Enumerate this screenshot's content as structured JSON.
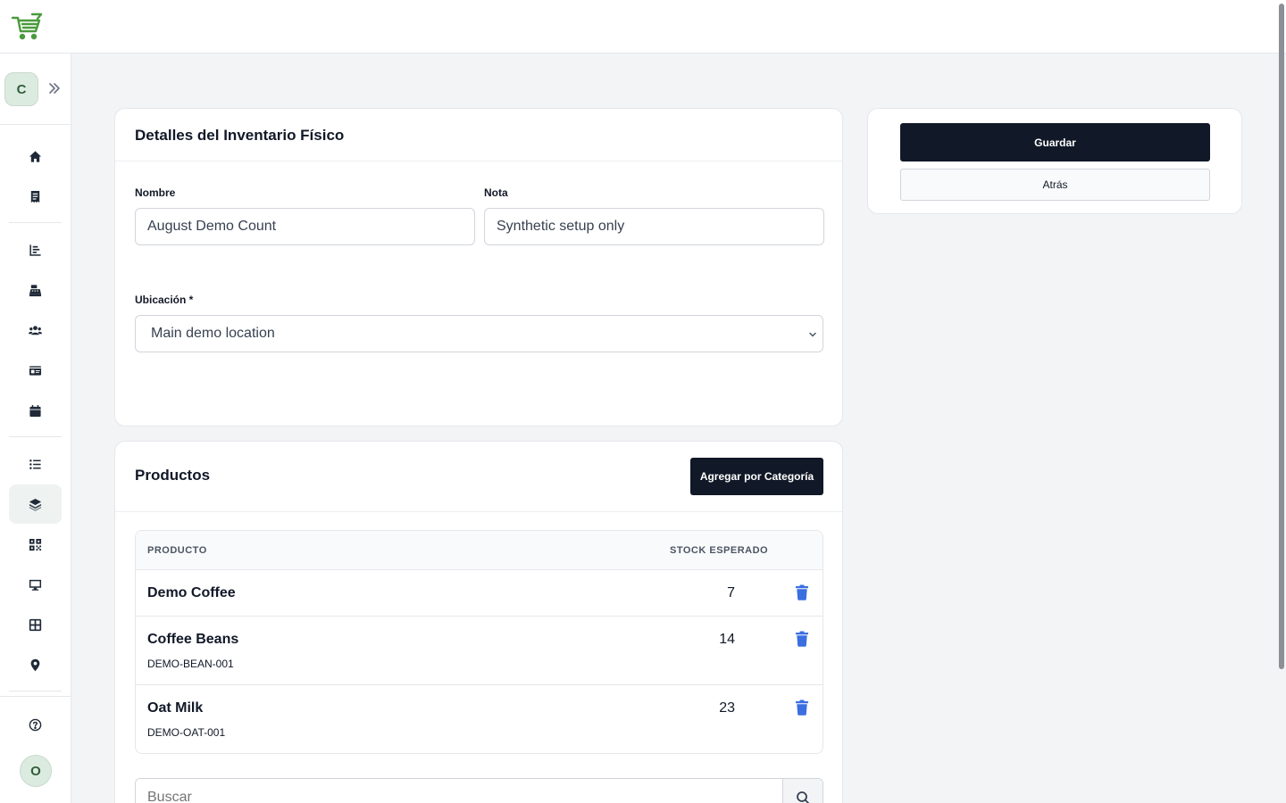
{
  "app": {
    "logo_icon": "shopping-cart-icon",
    "brand_color": "#4a9a3c"
  },
  "sidebar": {
    "company_initial": "C",
    "expand_icon": "chevrons-right-icon",
    "items": [
      {
        "icon": "home-icon"
      },
      {
        "icon": "receipt-icon"
      },
      {
        "icon": "chart-bar-icon"
      },
      {
        "icon": "cash-register-icon"
      },
      {
        "icon": "users-icon"
      },
      {
        "icon": "id-card-icon"
      },
      {
        "icon": "calendar-icon"
      },
      {
        "icon": "list-icon"
      },
      {
        "icon": "boxes-icon",
        "active": true
      },
      {
        "icon": "qr-code-icon"
      },
      {
        "icon": "monitor-icon"
      },
      {
        "icon": "grid-icon"
      },
      {
        "icon": "map-pin-icon"
      }
    ],
    "help_icon": "question-circle-icon",
    "user_initial": "O"
  },
  "details": {
    "title": "Detalles del Inventario Físico",
    "nombre_label": "Nombre",
    "nombre_value": "August Demo Count",
    "nota_label": "Nota",
    "nota_value": "Synthetic setup only",
    "ubicacion_label": "Ubicación *",
    "ubicacion_value": "Main demo location"
  },
  "actions": {
    "save_label": "Guardar",
    "back_label": "Atrás"
  },
  "products": {
    "title": "Productos",
    "add_by_category_label": "Agregar por Categoría",
    "columns": {
      "product": "PRODUCTO",
      "expected_stock": "STOCK ESPERADO"
    },
    "rows": [
      {
        "name": "Demo Coffee",
        "sku": "",
        "stock": "7"
      },
      {
        "name": "Coffee Beans",
        "sku": "DEMO-BEAN-001",
        "stock": "14"
      },
      {
        "name": "Oat Milk",
        "sku": "DEMO-OAT-001",
        "stock": "23"
      }
    ],
    "search_placeholder": "Buscar",
    "delete_color": "#3b6fe0"
  }
}
